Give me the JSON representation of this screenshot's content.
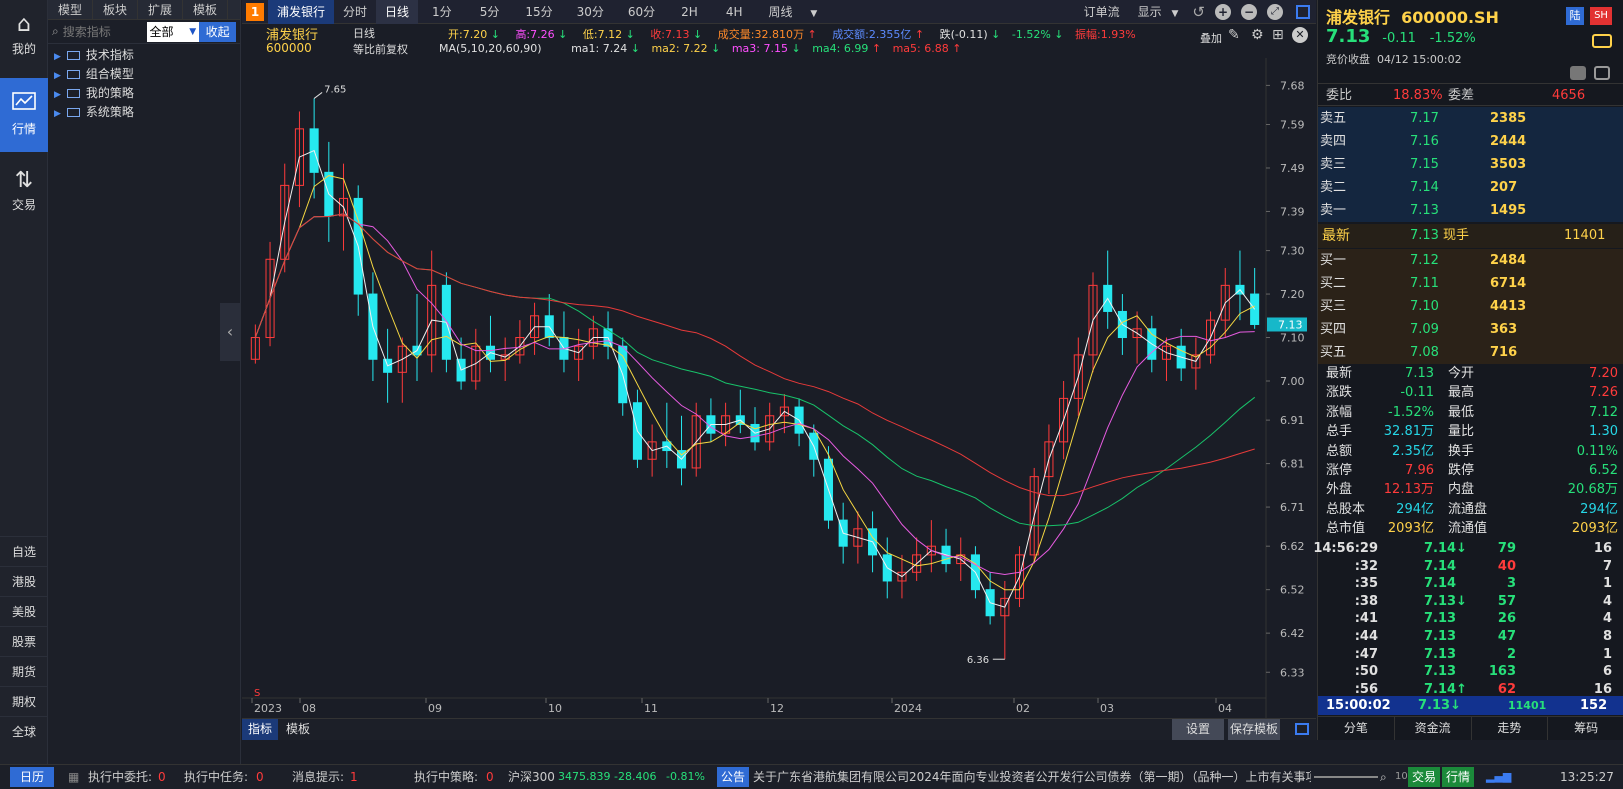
{
  "leftnav": {
    "top": [
      {
        "icon": "home-icon",
        "glyph": "⌂",
        "label": "我的"
      },
      {
        "icon": "market-chart-icon",
        "glyph": "📈",
        "label": "行情"
      },
      {
        "icon": "trade-icon",
        "glyph": "⇅",
        "label": "交易"
      }
    ],
    "bottom": [
      "自选",
      "港股",
      "美股",
      "股票",
      "期货",
      "期权",
      "全球"
    ]
  },
  "tree": {
    "tabs": [
      "模型",
      "板块",
      "扩展",
      "模板"
    ],
    "search_placeholder": "搜索指标",
    "scope": "全部",
    "collapse": "收起",
    "items": [
      "技术指标",
      "组合模型",
      "我的策略",
      "系统策略"
    ]
  },
  "topbar": {
    "num": "1",
    "stock_tab": "浦发银行",
    "periods": [
      "分时",
      "日线",
      "1分",
      "5分",
      "15分",
      "30分",
      "60分",
      "2H",
      "4H",
      "周线"
    ],
    "active_period": "日线",
    "order_flow": "订单流",
    "display": "显示"
  },
  "info": {
    "name": "浦发银行",
    "code": "600000",
    "period": "日线",
    "adjust": "等比前复权",
    "ma_label": "MA(5,10,20,60,90)",
    "open_l": "开:",
    "open_v": "7.20",
    "high_l": "高:",
    "high_v": "7.26",
    "low_l": "低:",
    "low_v": "7.12",
    "close_l": "收:",
    "close_v": "7.13",
    "vol_l": "成交量:",
    "vol_v": "32.810万",
    "amt_l": "成交额:",
    "amt_v": "2.355亿",
    "chg_l": "跌(-0.11)",
    "pct_v": "-1.52%",
    "amp_l": "振幅:",
    "amp_v": "1.93%",
    "overlay": "叠加",
    "ma1": "ma1: 7.24",
    "ma2": "ma2: 7.22",
    "ma3": "ma3: 7.15",
    "ma4": "ma4: 6.99",
    "ma5": "ma5: 6.88"
  },
  "colors": {
    "up": "#ff3b3b",
    "down": "#26e8ef",
    "ma1": "#f0f0f0",
    "ma2": "#f5d742",
    "ma3": "#e65be0",
    "ma4": "#18c26a",
    "ma5": "#e63a3a"
  },
  "chart_data": {
    "type": "candlestick",
    "ylim": [
      6.28,
      7.72
    ],
    "yticks": [
      "7.68",
      "7.59",
      "7.49",
      "7.39",
      "7.30",
      "7.20",
      "7.10",
      "7.00",
      "6.91",
      "6.81",
      "6.71",
      "6.62",
      "6.52",
      "6.42",
      "6.33"
    ],
    "xticks": [
      "2023",
      "08",
      "09",
      "10",
      "11",
      "12",
      "2024",
      "02",
      "03",
      "04"
    ],
    "high_label": "7.65",
    "low_label": "6.36",
    "last_price": "7.13",
    "ohlc": [
      [
        7.05,
        7.13,
        7.04,
        7.1
      ],
      [
        7.1,
        7.32,
        7.08,
        7.28
      ],
      [
        7.28,
        7.5,
        7.25,
        7.45
      ],
      [
        7.45,
        7.62,
        7.4,
        7.58
      ],
      [
        7.58,
        7.65,
        7.42,
        7.48
      ],
      [
        7.48,
        7.55,
        7.32,
        7.38
      ],
      [
        7.38,
        7.5,
        7.3,
        7.42
      ],
      [
        7.42,
        7.45,
        7.15,
        7.2
      ],
      [
        7.2,
        7.25,
        7.0,
        7.05
      ],
      [
        7.05,
        7.12,
        6.95,
        7.02
      ],
      [
        7.02,
        7.1,
        6.95,
        7.08
      ],
      [
        7.08,
        7.2,
        7.0,
        7.06
      ],
      [
        7.06,
        7.3,
        7.02,
        7.22
      ],
      [
        7.22,
        7.25,
        7.02,
        7.05
      ],
      [
        7.05,
        7.1,
        6.98,
        7.0
      ],
      [
        7.0,
        7.12,
        6.98,
        7.08
      ],
      [
        7.08,
        7.15,
        7.02,
        7.05
      ],
      [
        7.05,
        7.1,
        7.0,
        7.06
      ],
      [
        7.06,
        7.14,
        7.04,
        7.1
      ],
      [
        7.1,
        7.18,
        7.06,
        7.15
      ],
      [
        7.15,
        7.2,
        7.08,
        7.1
      ],
      [
        7.1,
        7.16,
        7.02,
        7.05
      ],
      [
        7.05,
        7.12,
        7.0,
        7.08
      ],
      [
        7.08,
        7.15,
        7.05,
        7.12
      ],
      [
        7.12,
        7.16,
        7.05,
        7.08
      ],
      [
        7.08,
        7.1,
        6.92,
        6.95
      ],
      [
        6.95,
        6.98,
        6.8,
        6.82
      ],
      [
        6.82,
        6.9,
        6.78,
        6.86
      ],
      [
        6.86,
        6.95,
        6.8,
        6.84
      ],
      [
        6.84,
        6.92,
        6.76,
        6.8
      ],
      [
        6.8,
        6.95,
        6.78,
        6.92
      ],
      [
        6.92,
        6.96,
        6.86,
        6.88
      ],
      [
        6.88,
        6.95,
        6.85,
        6.92
      ],
      [
        6.92,
        6.98,
        6.88,
        6.9
      ],
      [
        6.9,
        6.94,
        6.84,
        6.86
      ],
      [
        6.86,
        6.95,
        6.84,
        6.92
      ],
      [
        6.92,
        6.97,
        6.88,
        6.94
      ],
      [
        6.94,
        6.96,
        6.85,
        6.88
      ],
      [
        6.88,
        6.9,
        6.78,
        6.82
      ],
      [
        6.82,
        6.85,
        6.66,
        6.68
      ],
      [
        6.68,
        6.72,
        6.58,
        6.62
      ],
      [
        6.62,
        6.7,
        6.58,
        6.66
      ],
      [
        6.66,
        6.7,
        6.56,
        6.6
      ],
      [
        6.6,
        6.64,
        6.5,
        6.54
      ],
      [
        6.54,
        6.6,
        6.5,
        6.56
      ],
      [
        6.56,
        6.64,
        6.54,
        6.6
      ],
      [
        6.6,
        6.68,
        6.56,
        6.62
      ],
      [
        6.62,
        6.66,
        6.56,
        6.58
      ],
      [
        6.58,
        6.64,
        6.54,
        6.6
      ],
      [
        6.6,
        6.62,
        6.5,
        6.52
      ],
      [
        6.52,
        6.56,
        6.44,
        6.46
      ],
      [
        6.46,
        6.54,
        6.36,
        6.5
      ],
      [
        6.5,
        6.62,
        6.48,
        6.6
      ],
      [
        6.6,
        6.8,
        6.58,
        6.78
      ],
      [
        6.78,
        6.9,
        6.74,
        6.86
      ],
      [
        6.86,
        7.0,
        6.82,
        6.96
      ],
      [
        6.96,
        7.1,
        6.92,
        7.06
      ],
      [
        7.06,
        7.25,
        7.02,
        7.22
      ],
      [
        7.22,
        7.3,
        7.12,
        7.16
      ],
      [
        7.16,
        7.2,
        7.06,
        7.1
      ],
      [
        7.1,
        7.16,
        7.04,
        7.12
      ],
      [
        7.12,
        7.15,
        7.02,
        7.05
      ],
      [
        7.05,
        7.1,
        7.0,
        7.08
      ],
      [
        7.08,
        7.12,
        7.0,
        7.03
      ],
      [
        7.03,
        7.1,
        6.98,
        7.06
      ],
      [
        7.06,
        7.16,
        7.04,
        7.14
      ],
      [
        7.14,
        7.26,
        7.1,
        7.22
      ],
      [
        7.22,
        7.3,
        7.14,
        7.2
      ],
      [
        7.2,
        7.26,
        7.12,
        7.13
      ]
    ]
  },
  "rp": {
    "title_name": "浦发银行",
    "title_code": "600000.SH",
    "badge1": "陆",
    "badge2": "SH",
    "price": "7.13",
    "chg": "-0.11",
    "pct": "-1.52%",
    "status": "竞价收盘",
    "datetime": "04/12  15:00:02",
    "wb_l": "委比",
    "wb_v": "18.83%",
    "wc_l": "委差",
    "wc_v": "4656",
    "asks": [
      [
        "卖五",
        "7.17",
        "2385"
      ],
      [
        "卖四",
        "7.16",
        "2444"
      ],
      [
        "卖三",
        "7.15",
        "3503"
      ],
      [
        "卖二",
        "7.14",
        "207"
      ],
      [
        "卖一",
        "7.13",
        "1495"
      ]
    ],
    "last_l": "最新",
    "last_v": "7.13",
    "cur_l": "现手",
    "cur_v": "11401",
    "bids": [
      [
        "买一",
        "7.12",
        "2484"
      ],
      [
        "买二",
        "7.11",
        "6714"
      ],
      [
        "买三",
        "7.10",
        "4413"
      ],
      [
        "买四",
        "7.09",
        "363"
      ],
      [
        "买五",
        "7.08",
        "716"
      ]
    ],
    "stats": [
      [
        "最新",
        "7.13",
        "今开",
        "7.20"
      ],
      [
        "涨跌",
        "-0.11",
        "最高",
        "7.26"
      ],
      [
        "涨幅",
        "-1.52%",
        "最低",
        "7.12"
      ],
      [
        "总手",
        "32.81万",
        "量比",
        "1.30"
      ],
      [
        "总额",
        "2.35亿",
        "换手",
        "0.11%"
      ],
      [
        "涨停",
        "7.96",
        "跌停",
        "6.52"
      ],
      [
        "外盘",
        "12.13万",
        "内盘",
        "20.68万"
      ],
      [
        "总股本",
        "294亿",
        "流通盘",
        "294亿"
      ],
      [
        "总市值",
        "2093亿",
        "流通值",
        "2093亿"
      ]
    ],
    "ticks": [
      [
        "14:56:29",
        "7.14↓",
        "79",
        "16"
      ],
      [
        ":32",
        "7.14",
        "40",
        "7"
      ],
      [
        ":35",
        "7.14",
        "3",
        "1"
      ],
      [
        ":38",
        "7.13↓",
        "57",
        "4"
      ],
      [
        ":41",
        "7.13",
        "26",
        "4"
      ],
      [
        ":44",
        "7.13",
        "47",
        "8"
      ],
      [
        ":47",
        "7.13",
        "2",
        "1"
      ],
      [
        ":50",
        "7.13",
        "163",
        "6"
      ],
      [
        ":56",
        "7.14↑",
        "62",
        "16"
      ]
    ],
    "lasttick": [
      "15:00:02",
      "7.13↓",
      "11401",
      "152"
    ],
    "tabs": [
      "分笔",
      "资金流",
      "走势",
      "筹码"
    ]
  },
  "chartbottom": {
    "tab1": "指标",
    "tab2": "模板",
    "settings": "设置",
    "save": "保存模板"
  },
  "bottombar": {
    "calendar": "日历",
    "entrust_l": "执行中委托:",
    "entrust_v": "0",
    "task_l": "执行中任务:",
    "task_v": "0",
    "msg_l": "消息提示:",
    "msg_v": "1",
    "strat_l": "执行中策略:",
    "strat_v": "0",
    "idx_name": "沪深300",
    "idx_v": "3475.839",
    "idx_chg": "-28.406",
    "idx_pct": "-0.81%",
    "notice_l": "公告",
    "notice": "关于广东省港航集团有限公司2024年面向专业投资者公开发行公司债券（第一期）（品种一）上市有关事项的通",
    "zoom": "100%",
    "trade": "交易",
    "quote": "行情",
    "time": "13:25:27"
  }
}
